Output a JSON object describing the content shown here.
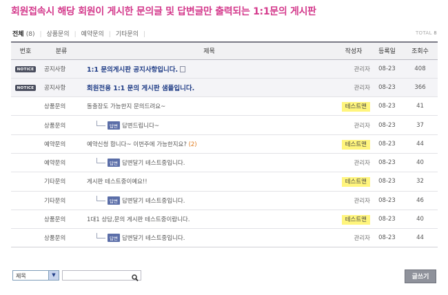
{
  "page_title": "회원접속시 해당 회원이 게시한 문의글 및 답변글만 출력되는 1:1문의 게시판",
  "categories": [
    {
      "label": "전체",
      "count": "(8)",
      "active": true
    },
    {
      "label": "상품문의"
    },
    {
      "label": "예약문의"
    },
    {
      "label": "기타문의"
    }
  ],
  "total": {
    "label": "TOTAL",
    "value": "8"
  },
  "table": {
    "headers": {
      "num": "번호",
      "category": "분류",
      "subject": "제목",
      "author": "작성자",
      "date": "등록일",
      "views": "조회수"
    },
    "notice_badge": "NOTICE",
    "reply_badge": "답변",
    "rows": [
      {
        "notice": true,
        "category": "공지사항",
        "subject": "1:1 문의게시판 공지사항입니다.",
        "has_file": true,
        "author": "관리자",
        "date": "08-23",
        "views": "408"
      },
      {
        "notice": true,
        "category": "공지사항",
        "subject": "회원전용 1:1 문의 게시판 샘플입니다.",
        "author": "관리자",
        "date": "08-23",
        "views": "366"
      },
      {
        "category": "상품문의",
        "subject": "돌출장도 가능한지 문의드려요~",
        "author": "테스트맨",
        "highlight": true,
        "date": "08-23",
        "views": "41"
      },
      {
        "category": "상품문의",
        "reply": true,
        "subject": "답변드립니다~",
        "author": "관리자",
        "date": "08-23",
        "views": "37"
      },
      {
        "category": "예약문의",
        "subject": "예약신청 합니다~ 이번주에 가능한지요?",
        "comments": "(2)",
        "author": "테스트맨",
        "highlight": true,
        "date": "08-23",
        "views": "44"
      },
      {
        "category": "예약문의",
        "reply": true,
        "subject": "답변달기 테스트중입니다.",
        "author": "관리자",
        "date": "08-23",
        "views": "40"
      },
      {
        "category": "기타문의",
        "subject": "게시판 테스트중이예요!!",
        "author": "테스트맨",
        "highlight": true,
        "date": "08-23",
        "views": "32"
      },
      {
        "category": "기타문의",
        "reply": true,
        "subject": "답변달기 테스트중입니다.",
        "author": "관리자",
        "date": "08-23",
        "views": "46"
      },
      {
        "category": "상품문의",
        "subject": "1대1 상담,문의 게시판 테스트중이랍니다.",
        "author": "테스트맨",
        "highlight": true,
        "date": "08-23",
        "views": "40"
      },
      {
        "category": "상품문의",
        "reply": true,
        "subject": "답변달기 테스트중입니다.",
        "author": "관리자",
        "date": "08-23",
        "views": "44"
      }
    ]
  },
  "search": {
    "select_value": "제목",
    "input_value": ""
  },
  "write_button": "글쓰기",
  "colors": {
    "title": "#d43a8c",
    "notice_subject": "#1f3c86",
    "highlight": "#fff57d",
    "comment": "#e07b1c"
  }
}
